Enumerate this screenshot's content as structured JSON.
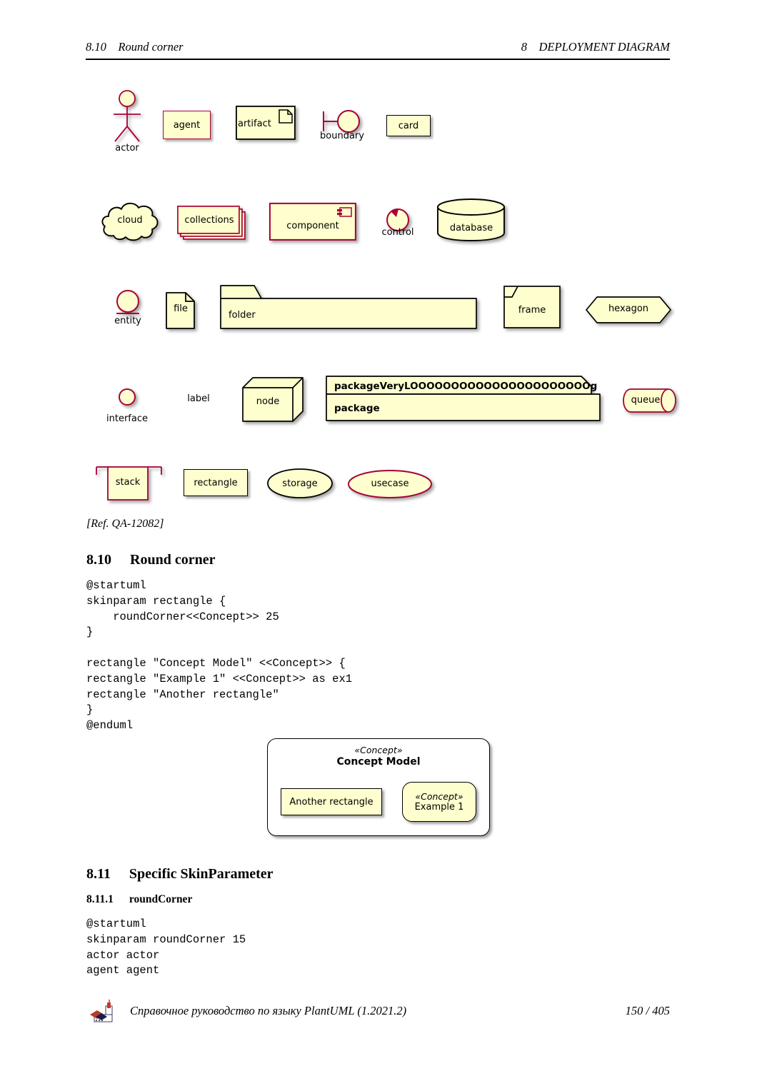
{
  "header": {
    "left": "8.10    Round corner",
    "right": "8    DEPLOYMENT DIAGRAM"
  },
  "diagram_shapes": {
    "row1": [
      {
        "name": "actor",
        "label": "actor",
        "caption_below": true,
        "style": "stick-figure",
        "border": "#A80036"
      },
      {
        "name": "agent",
        "label": "agent",
        "caption_below": false,
        "style": "rectangle",
        "border": "#A80036"
      },
      {
        "name": "artifact",
        "label": "artifact",
        "caption_below": false,
        "style": "rectangle-with-doc-icon",
        "border": "#000000"
      },
      {
        "name": "boundary",
        "label": "boundary",
        "caption_below": true,
        "style": "boundary-circle-bar",
        "border": "#A80036"
      },
      {
        "name": "card",
        "label": "card",
        "caption_below": false,
        "style": "rectangle",
        "border": "#000000"
      }
    ],
    "row2": [
      {
        "name": "cloud",
        "label": "cloud",
        "caption_below": false,
        "style": "cloud",
        "border": "#000000"
      },
      {
        "name": "collections",
        "label": "collections",
        "caption_below": false,
        "style": "stacked-rectangles",
        "border": "#A80036"
      },
      {
        "name": "component",
        "label": "component",
        "caption_below": false,
        "style": "component",
        "border": "#A80036"
      },
      {
        "name": "control",
        "label": "control",
        "caption_below": true,
        "style": "control-circle-arrow",
        "border": "#A80036"
      },
      {
        "name": "database",
        "label": "database",
        "caption_below": false,
        "style": "cylinder",
        "border": "#000000"
      }
    ],
    "row3": [
      {
        "name": "entity",
        "label": "entity",
        "caption_below": true,
        "style": "entity-circle-line",
        "border": "#A80036"
      },
      {
        "name": "file",
        "label": "file",
        "caption_below": false,
        "style": "file-dogear",
        "border": "#000000"
      },
      {
        "name": "folder",
        "label": "folder",
        "caption_below": false,
        "style": "folder-tab",
        "border": "#000000"
      },
      {
        "name": "frame",
        "label": "frame",
        "caption_below": false,
        "style": "frame-notch",
        "border": "#000000"
      },
      {
        "name": "hexagon",
        "label": "hexagon",
        "caption_below": false,
        "style": "hexagon",
        "border": "#000000"
      }
    ],
    "row4": [
      {
        "name": "interface",
        "label": "interface",
        "caption_below": true,
        "style": "small-circle",
        "border": "#A80036"
      },
      {
        "name": "label",
        "label": "label",
        "caption_below": false,
        "style": "plain-text",
        "border": "none"
      },
      {
        "name": "node",
        "label": "node",
        "caption_below": false,
        "style": "node-3d-box",
        "border": "#000000"
      },
      {
        "name": "package",
        "label": "package",
        "caption_below": false,
        "style": "package-tabbed",
        "border": "#000000",
        "header_text": "packageVeryLOOOOOOOOOOOOOOOOOOOOOOg"
      },
      {
        "name": "queue",
        "label": "queue",
        "caption_below": false,
        "style": "queue-cylinder",
        "border": "#A80036"
      }
    ],
    "row5": [
      {
        "name": "stack",
        "label": "stack",
        "caption_below": false,
        "style": "stack-bracket",
        "border": "#A80036"
      },
      {
        "name": "rectangle",
        "label": "rectangle",
        "caption_below": false,
        "style": "rectangle",
        "border": "#000000"
      },
      {
        "name": "storage",
        "label": "storage",
        "caption_below": false,
        "style": "ellipse",
        "border": "#000000"
      },
      {
        "name": "usecase",
        "label": "usecase",
        "caption_below": false,
        "style": "ellipse",
        "border": "#A80036"
      }
    ],
    "fill_color": "#FEFECE",
    "accent_color": "#A80036"
  },
  "ref_note": "[Ref. QA-12082]",
  "section_810": {
    "number": "8.10",
    "title": "Round corner",
    "code": "@startuml\nskinparam rectangle {\n    roundCorner<<Concept>> 25\n}\n\nrectangle \"Concept Model\" <<Concept>> {\nrectangle \"Example 1\" <<Concept>> as ex1\nrectangle \"Another rectangle\"\n}\n@enduml"
  },
  "concept_model": {
    "stereotype": "«Concept»",
    "title": "Concept Model",
    "child_rectangle": "Another rectangle",
    "child_concept_stereotype": "«Concept»",
    "child_concept_name": "Example 1"
  },
  "section_811": {
    "number": "8.11",
    "title": "Specific SkinParameter"
  },
  "section_8111": {
    "number": "8.11.1",
    "title": "roundCorner",
    "code": "@startuml\nskinparam roundCorner 15\nactor actor\nagent agent"
  },
  "footer": {
    "text": "Справочное руководство по языку PlantUML (1.2021.2)",
    "page": "150 / 405"
  }
}
